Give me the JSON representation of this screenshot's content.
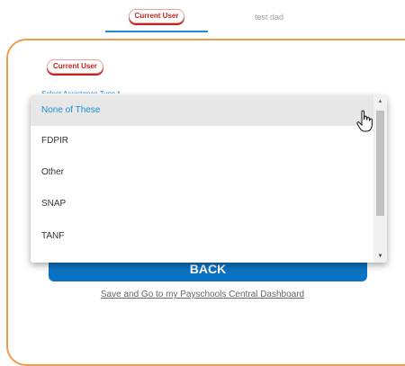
{
  "tabs": [
    {
      "label": "Current User"
    },
    {
      "label": "test dad"
    }
  ],
  "card": {
    "badge": "Current User",
    "field_label": "Select Assistance Type *"
  },
  "dropdown": {
    "options": [
      "None of These",
      "FDPIR",
      "Other",
      "SNAP",
      "TANF"
    ],
    "selected": "None of These"
  },
  "back_button": "BACK",
  "save_link": "Save and Go to my Payschools Central Dashboard",
  "icons": {
    "cursor": "hand-pointer-icon",
    "scroll_up": "triangle-up-icon",
    "scroll_down": "triangle-down-icon"
  },
  "colors": {
    "accent": "#1a8fd6",
    "card_border": "#f29b4c",
    "button": "#0b73c4",
    "badge_text": "#c2251f"
  }
}
